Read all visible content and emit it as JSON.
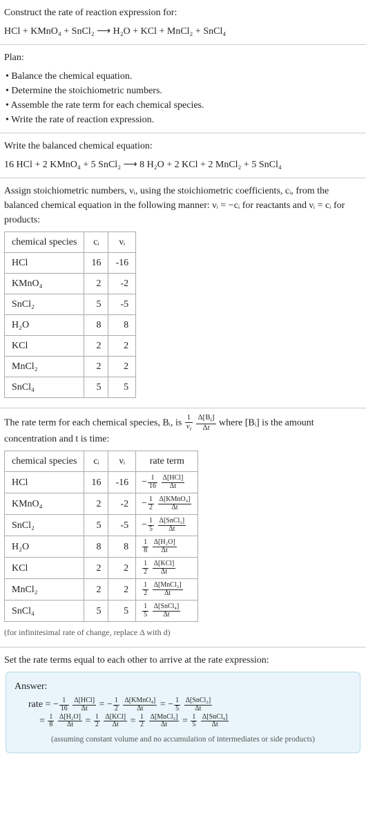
{
  "header": {
    "title": "Construct the rate of reaction expression for:",
    "equation": "HCl + KMnO₄ + SnCl₂  ⟶  H₂O + KCl + MnCl₂ + SnCl₄"
  },
  "plan": {
    "title": "Plan:",
    "items": [
      "• Balance the chemical equation.",
      "• Determine the stoichiometric numbers.",
      "• Assemble the rate term for each chemical species.",
      "• Write the rate of reaction expression."
    ]
  },
  "balanced": {
    "title": "Write the balanced chemical equation:",
    "equation": "16 HCl + 2 KMnO₄ + 5 SnCl₂  ⟶  8 H₂O + 2 KCl + 2 MnCl₂ + 5 SnCl₄"
  },
  "assign": {
    "intro": "Assign stoichiometric numbers, νᵢ, using the stoichiometric coefficients, cᵢ, from the balanced chemical equation in the following manner: νᵢ = −cᵢ for reactants and νᵢ = cᵢ for products:",
    "headers": {
      "sp": "chemical species",
      "c": "cᵢ",
      "v": "νᵢ"
    },
    "rows": [
      {
        "sp": "HCl",
        "c": "16",
        "v": "-16"
      },
      {
        "sp": "KMnO₄",
        "c": "2",
        "v": "-2"
      },
      {
        "sp": "SnCl₂",
        "c": "5",
        "v": "-5"
      },
      {
        "sp": "H₂O",
        "c": "8",
        "v": "8"
      },
      {
        "sp": "KCl",
        "c": "2",
        "v": "2"
      },
      {
        "sp": "MnCl₂",
        "c": "2",
        "v": "2"
      },
      {
        "sp": "SnCl₄",
        "c": "5",
        "v": "5"
      }
    ]
  },
  "rateterm": {
    "intro_a": "The rate term for each chemical species, Bᵢ, is ",
    "intro_b": " where [Bᵢ] is the amount concentration and t is time:",
    "headers": {
      "sp": "chemical species",
      "c": "cᵢ",
      "v": "νᵢ",
      "r": "rate term"
    },
    "rows": [
      {
        "sp": "HCl",
        "c": "16",
        "v": "-16",
        "sign": "−",
        "coef_num": "1",
        "coef_den": "16",
        "dnum": "Δ[HCl]",
        "dden": "Δt"
      },
      {
        "sp": "KMnO₄",
        "c": "2",
        "v": "-2",
        "sign": "−",
        "coef_num": "1",
        "coef_den": "2",
        "dnum": "Δ[KMnO₄]",
        "dden": "Δt"
      },
      {
        "sp": "SnCl₂",
        "c": "5",
        "v": "-5",
        "sign": "−",
        "coef_num": "1",
        "coef_den": "5",
        "dnum": "Δ[SnCl₂]",
        "dden": "Δt"
      },
      {
        "sp": "H₂O",
        "c": "8",
        "v": "8",
        "sign": "",
        "coef_num": "1",
        "coef_den": "8",
        "dnum": "Δ[H₂O]",
        "dden": "Δt"
      },
      {
        "sp": "KCl",
        "c": "2",
        "v": "2",
        "sign": "",
        "coef_num": "1",
        "coef_den": "2",
        "dnum": "Δ[KCl]",
        "dden": "Δt"
      },
      {
        "sp": "MnCl₂",
        "c": "2",
        "v": "2",
        "sign": "",
        "coef_num": "1",
        "coef_den": "2",
        "dnum": "Δ[MnCl₂]",
        "dden": "Δt"
      },
      {
        "sp": "SnCl₄",
        "c": "5",
        "v": "5",
        "sign": "",
        "coef_num": "1",
        "coef_den": "5",
        "dnum": "Δ[SnCl₄]",
        "dden": "Δt"
      }
    ],
    "note": "(for infinitesimal rate of change, replace Δ with d)"
  },
  "final": {
    "intro": "Set the rate terms equal to each other to arrive at the rate expression:",
    "label": "Answer:",
    "terms": [
      {
        "prefix": "rate = −",
        "cn": "1",
        "cd": "16",
        "dn": "Δ[HCl]",
        "dd": "Δt"
      },
      {
        "prefix": " = −",
        "cn": "1",
        "cd": "2",
        "dn": "Δ[KMnO₄]",
        "dd": "Δt"
      },
      {
        "prefix": " = −",
        "cn": "1",
        "cd": "5",
        "dn": "Δ[SnCl₂]",
        "dd": "Δt"
      },
      {
        "prefix": "= ",
        "cn": "1",
        "cd": "8",
        "dn": "Δ[H₂O]",
        "dd": "Δt"
      },
      {
        "prefix": " = ",
        "cn": "1",
        "cd": "2",
        "dn": "Δ[KCl]",
        "dd": "Δt"
      },
      {
        "prefix": " = ",
        "cn": "1",
        "cd": "2",
        "dn": "Δ[MnCl₂]",
        "dd": "Δt"
      },
      {
        "prefix": " = ",
        "cn": "1",
        "cd": "5",
        "dn": "Δ[SnCl₄]",
        "dd": "Δt"
      }
    ],
    "note": "(assuming constant volume and no accumulation of intermediates or side products)"
  }
}
